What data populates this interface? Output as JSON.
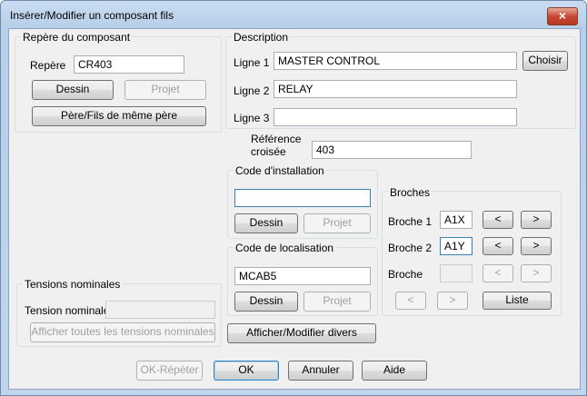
{
  "window": {
    "title": "Insérer/Modifier un composant fils",
    "close_icon": "×"
  },
  "repere_group": {
    "title": "Repère du composant",
    "repere_label": "Repère",
    "repere_value": "CR403",
    "dessin_button": "Dessin",
    "projet_button": "Projet",
    "pere_fils_button": "Père/Fils de même père"
  },
  "description_group": {
    "title": "Description",
    "ligne1_label": "Ligne 1",
    "ligne1_value": "MASTER CONTROL",
    "choisir_button": "Choisir",
    "ligne2_label": "Ligne 2",
    "ligne2_value": "RELAY",
    "ligne3_label": "Ligne 3",
    "ligne3_value": ""
  },
  "reference": {
    "label_line1": "Référence",
    "label_line2": "croisée",
    "value": "403"
  },
  "installation_group": {
    "title": "Code d'installation",
    "value": "",
    "dessin_button": "Dessin",
    "projet_button": "Projet"
  },
  "localisation_group": {
    "title": "Code de localisation",
    "value": "MCAB5",
    "dessin_button": "Dessin",
    "projet_button": "Projet"
  },
  "broches_group": {
    "title": "Broches",
    "broche1_label": "Broche 1",
    "broche1_value": "A1X",
    "broche2_label": "Broche 2",
    "broche2_value": "A1Y",
    "broche_label": "Broche",
    "broche_value": "",
    "prev": "<",
    "next": ">",
    "liste_button": "Liste"
  },
  "tensions_group": {
    "title": "Tensions nominales",
    "tension_label": "Tension nominale",
    "tension_value": "",
    "afficher_button": "Afficher toutes les tensions nominales"
  },
  "afficher_modifier_button": "Afficher/Modifier divers",
  "footer": {
    "ok_repeter": "OK-Répéter",
    "ok": "OK",
    "annuler": "Annuler",
    "aide": "Aide"
  }
}
